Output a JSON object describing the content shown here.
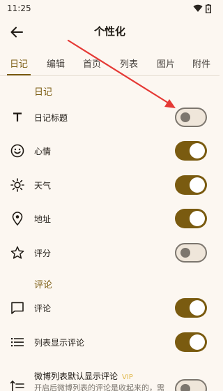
{
  "status_bar": {
    "time": "11:25"
  },
  "app_bar": {
    "title": "个性化"
  },
  "tabs": [
    {
      "label": "日记",
      "active": true
    },
    {
      "label": "编辑",
      "active": false
    },
    {
      "label": "首页",
      "active": false
    },
    {
      "label": "列表",
      "active": false
    },
    {
      "label": "图片",
      "active": false
    },
    {
      "label": "附件",
      "active": false
    }
  ],
  "sections": {
    "diary": {
      "header": "日记",
      "items": [
        {
          "label": "日记标题",
          "icon": "title-icon",
          "enabled": false
        },
        {
          "label": "心情",
          "icon": "smiley-icon",
          "enabled": true
        },
        {
          "label": "天气",
          "icon": "sun-icon",
          "enabled": true
        },
        {
          "label": "地址",
          "icon": "location-pin-icon",
          "enabled": true
        },
        {
          "label": "评分",
          "icon": "star-icon",
          "enabled": false
        }
      ]
    },
    "comments": {
      "header": "评论",
      "items": [
        {
          "label": "评论",
          "icon": "comment-icon",
          "enabled": true
        },
        {
          "label": "列表显示评论",
          "icon": "list-icon",
          "enabled": true
        },
        {
          "label": "微博列表默认显示评论",
          "badge": "VIP",
          "description": "开启后微博列表的评论是收起来的，需",
          "icon": "sort-icon",
          "enabled": false
        }
      ]
    }
  },
  "colors": {
    "accent": "#7A5B10",
    "background": "#FCF7F1",
    "annotation_arrow": "#E53935"
  }
}
